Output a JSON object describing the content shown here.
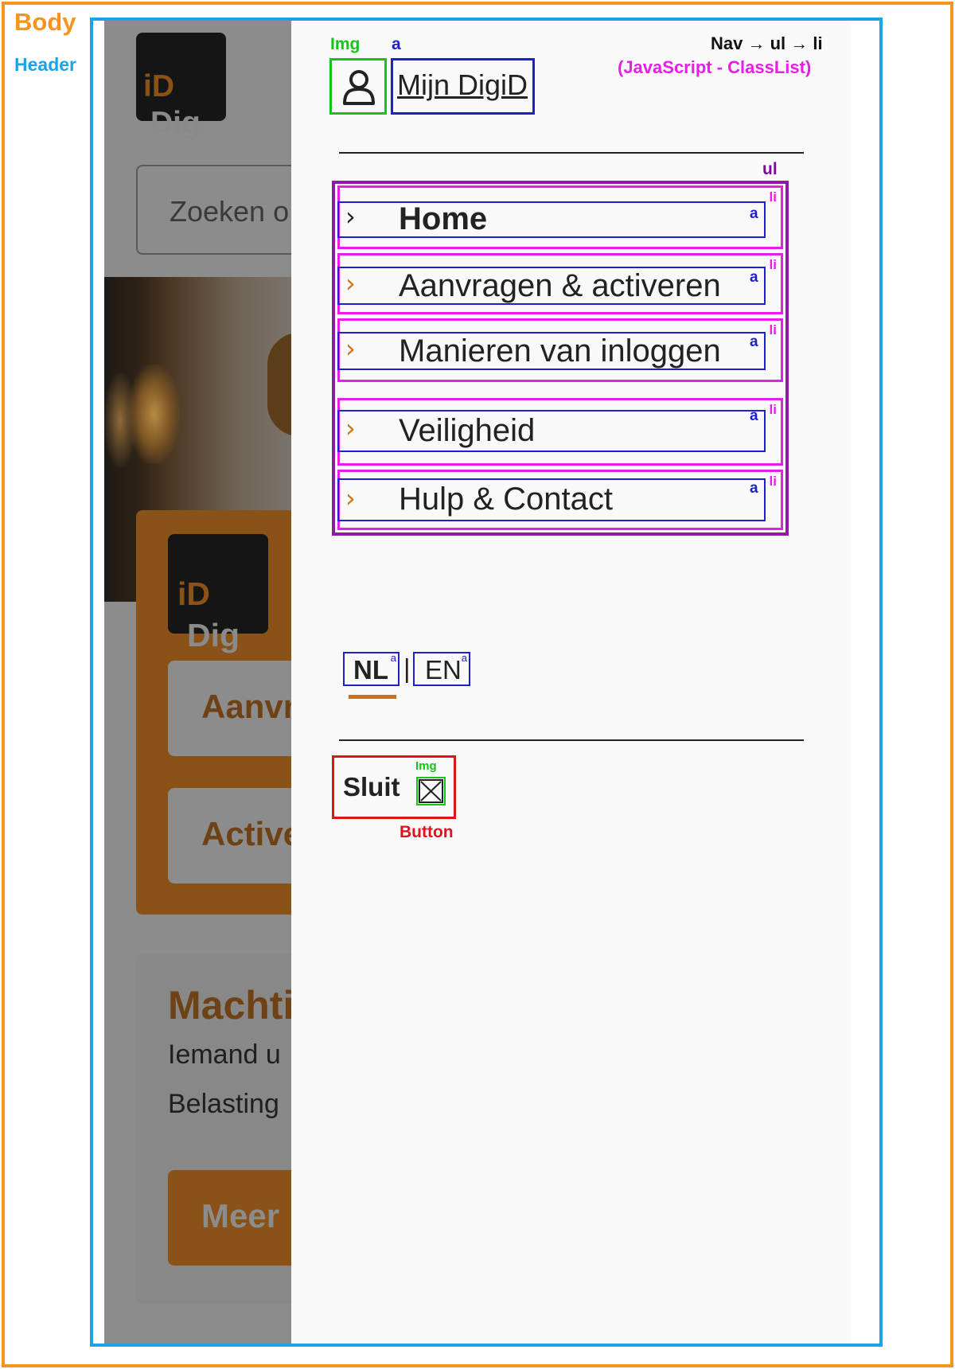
{
  "annotations": {
    "body": "Body",
    "header": "Header",
    "img": "Img",
    "a": "a",
    "nav_path": "Nav → ul → li",
    "nav_note": "(JavaScript - ClassList)",
    "ul": "ul",
    "li": "li",
    "button": "Button"
  },
  "background_page": {
    "logo": {
      "prefix": "Dig",
      "suffix": "iD"
    },
    "search_placeholder": "Zoeken o",
    "buttons": [
      "Aanvr",
      "Active"
    ],
    "card": {
      "title": "Machti",
      "line1": "Iemand u",
      "line2": "Belasting",
      "more_button": "Meer"
    }
  },
  "drawer": {
    "account_link": "Mijn DigiD",
    "account_icon": "user-icon",
    "menu": [
      {
        "label": "Home",
        "active": true
      },
      {
        "label": "Aanvragen & activeren",
        "active": false
      },
      {
        "label": "Manieren van inloggen",
        "active": false
      },
      {
        "label": "Veiligheid",
        "active": false
      },
      {
        "label": "Hulp & Contact",
        "active": false
      }
    ],
    "chevron": "›",
    "languages": {
      "nl": "NL",
      "separator": "|",
      "en": "EN",
      "active": "NL"
    },
    "close_button": "Sluit",
    "close_icon": "close-icon"
  },
  "colors": {
    "body_frame": "#f7941d",
    "header_frame": "#1aa3e8",
    "img_frame": "#19c219",
    "link_frame": "#1f1fd1",
    "li_frame": "#e81ee8",
    "ul_frame": "#8c1d9e",
    "button_frame": "#e0121b",
    "accent": "#d27214"
  }
}
